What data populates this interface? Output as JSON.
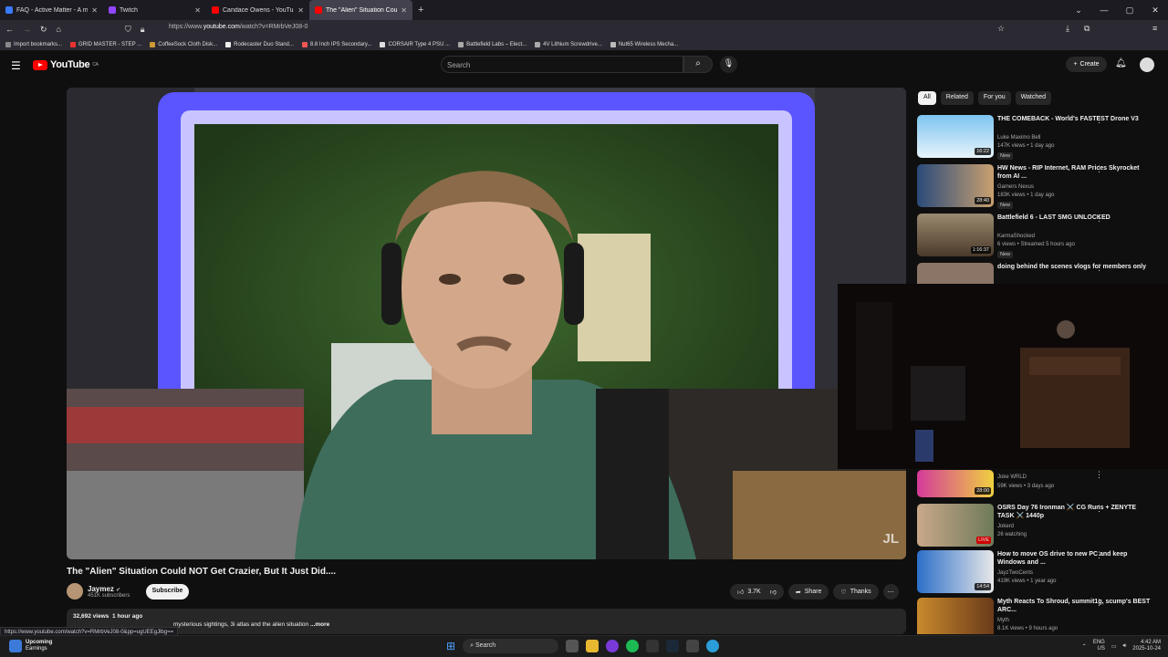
{
  "browser": {
    "tabs": [
      {
        "title": "FAQ - Active Matter - A mind-b",
        "color": "#3a7afe"
      },
      {
        "title": "Twitch",
        "color": "#9146ff"
      },
      {
        "title": "Candace Owens - YouTube",
        "color": "#ff0000"
      },
      {
        "title": "The \"Alien\" Situation Could NC",
        "color": "#ff0000"
      }
    ],
    "url_prefix": "https://www.",
    "url_domain": "youtube.com",
    "url_path": "/watch?v=RMrbVeJ08-0",
    "bookmarks": [
      "Import bookmarks...",
      "GRID MASTER - STEP ...",
      "CoffeeSock Cloth Disk...",
      "Rodecaster Duo Stand...",
      "8.8 Inch IPS Secondary...",
      "CORSAIR Type 4 PSU ...",
      "Battlefield Labs – Elect...",
      "4V Lithium Screwdrive...",
      "Nut65 Wireless Mecha..."
    ]
  },
  "youtube": {
    "logo_text": "YouTube",
    "region": "CA",
    "search_placeholder": "Search",
    "create_label": "Create"
  },
  "video": {
    "watermark": "JL",
    "title": "The \"Alien\" Situation Could NOT Get Crazier, But It Just Did....",
    "channel": "Jaymez",
    "subscribers": "451K subscribers",
    "subscribe_label": "Subscribe",
    "likes": "3.7K",
    "share_label": "Share",
    "thanks_label": "Thanks",
    "views": "32,692 views",
    "age": "1 hour ago",
    "description": "mysterious sightings, 3i atlas and the alien situation",
    "more_label": "...more"
  },
  "status_url": "https://www.youtube.com/watch?v=RMrbVeJ08-0&pp=ugUEEgJlbg==",
  "sidebar": {
    "chips": [
      "All",
      "Related",
      "For you",
      "Watched"
    ],
    "recommendations": [
      {
        "title": "THE COMEBACK - World's FASTEST Drone V3",
        "channel": "Luke Maximo Bell",
        "meta": "147K views • 1 day ago",
        "badge": "New",
        "duration": "16:22",
        "thumb": "#5ab0e0"
      },
      {
        "title": "HW News - RIP Internet, RAM Prices Skyrocket from AI ...",
        "channel": "Gamers Nexus",
        "meta": "183K views • 1 day ago",
        "badge": "New",
        "duration": "28:40",
        "thumb": "#3c5d8a"
      },
      {
        "title": "Battlefield 6 - LAST SMG UNLOCKED",
        "channel": "KarmaShocked",
        "meta": "6 views • Streamed 5 hours ago",
        "badge": "New",
        "duration": "1:16:37",
        "thumb": "#7a6a55"
      },
      {
        "title": "doing behind the scenes vlogs for members only",
        "channel": "",
        "meta": "",
        "badge": "",
        "duration": "",
        "thumb": "#8a7566"
      },
      {
        "title": "",
        "channel": "Joke WRLD",
        "meta": "59K views • 3 days ago",
        "badge": "",
        "duration": "28:00",
        "thumb": "#c43a8a"
      },
      {
        "title": "OSRS Day 76 Ironman ⚔️ CG Runs + ZENYTE TASK ⚔️ 1440p",
        "channel": "Jokerd",
        "meta": "26 watching",
        "badge": "",
        "duration": "LIVE",
        "thumb": "#6e7a5a"
      },
      {
        "title": "How to move OS drive to new PC and keep Windows and ...",
        "channel": "JayzTwoCents",
        "meta": "419K views • 1 year ago",
        "badge": "",
        "duration": "14:54",
        "thumb": "#2c6fc9"
      },
      {
        "title": "Myth Reacts To Shroud, summit1g, scump's BEST ARC...",
        "channel": "Myth",
        "meta": "8.1K views • 9 hours ago",
        "badge": "",
        "duration": "",
        "thumb": "#c98a2c"
      }
    ]
  },
  "taskbar": {
    "widget_title": "Upcoming",
    "widget_sub": "Earnings",
    "search_label": "Search",
    "lang": "ENG",
    "region": "US",
    "time": "4:42 AM",
    "date": "2025-10-24"
  }
}
